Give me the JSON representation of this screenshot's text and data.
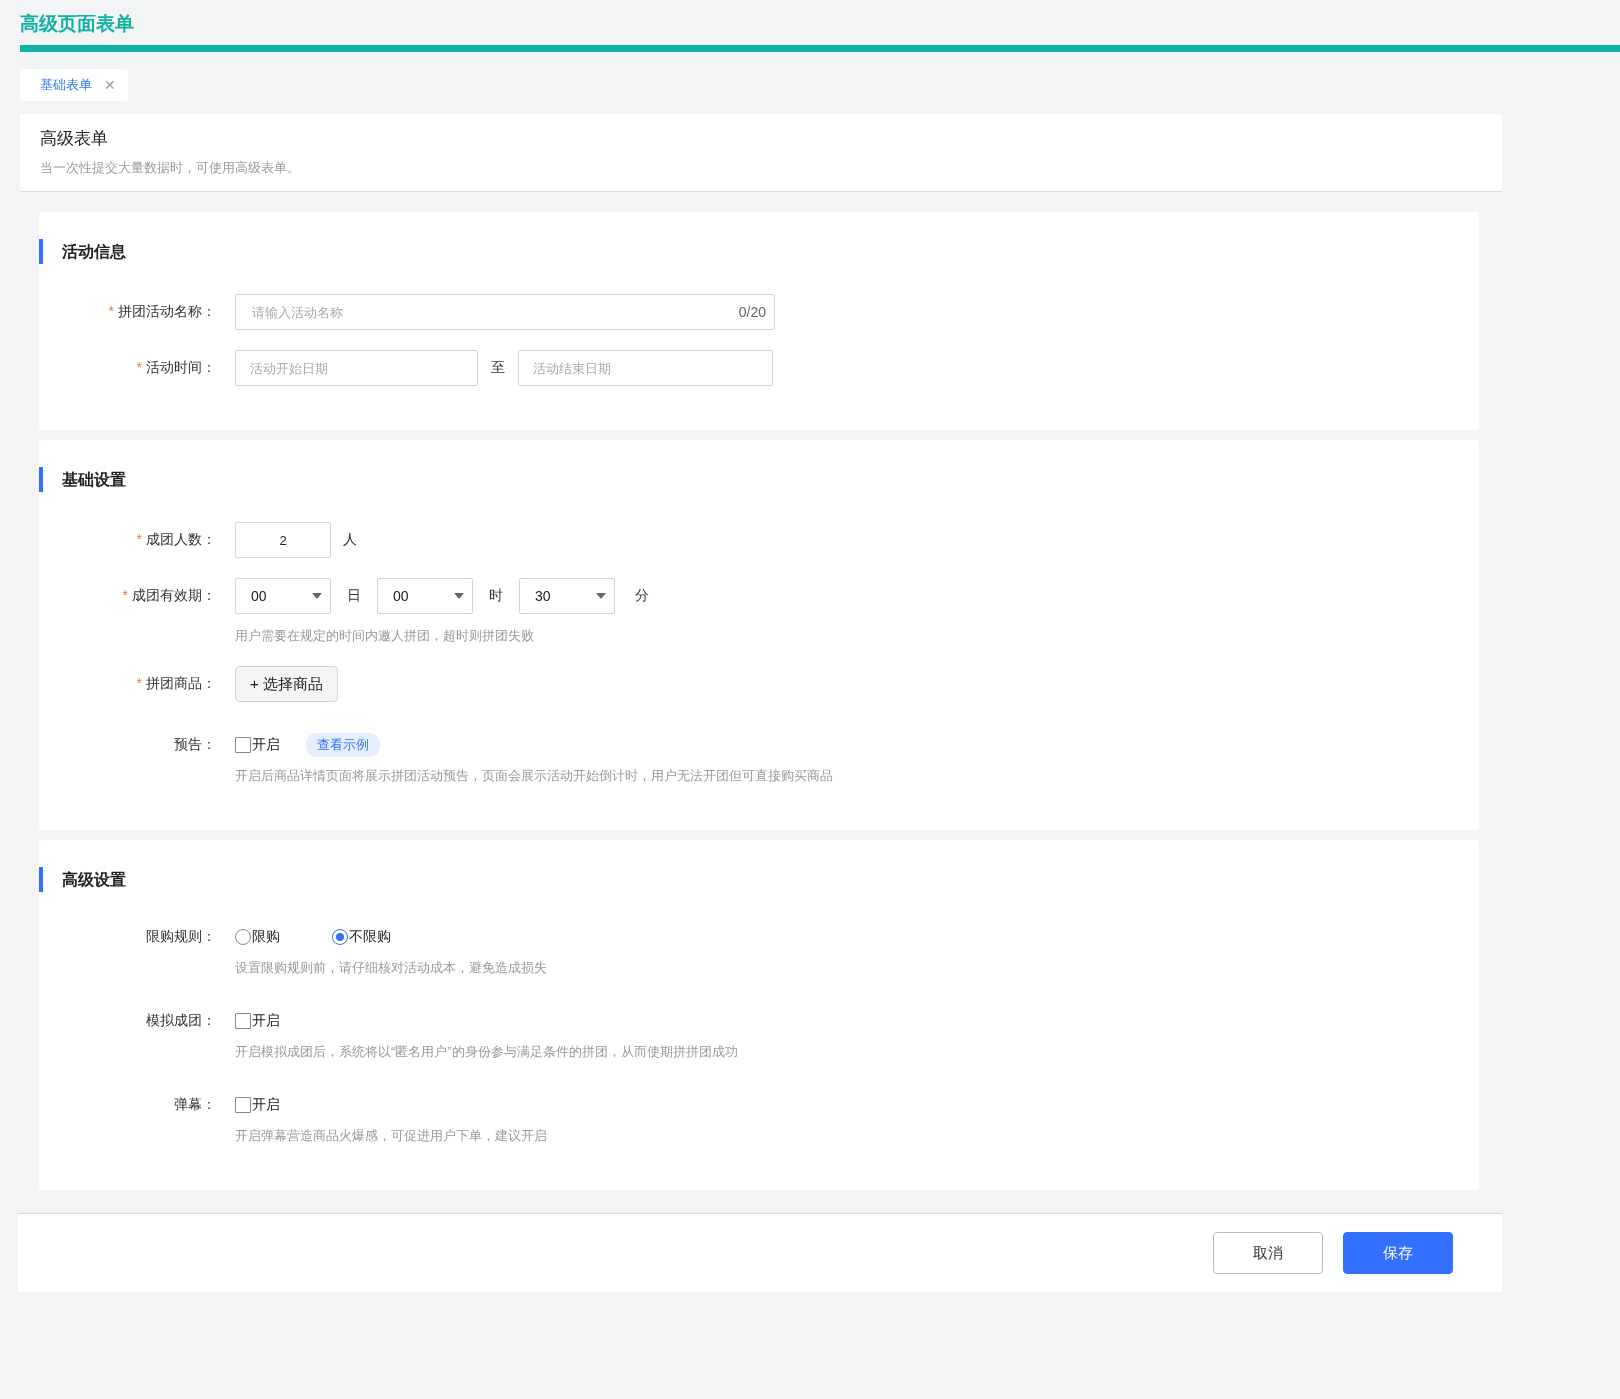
{
  "app_title": "高级页面表单",
  "tabs": [
    {
      "label": "基础表单",
      "selected": true,
      "close": "✕"
    }
  ],
  "page_header": {
    "title": "高级表单",
    "description": "当一次性提交大量数据时，可使用高级表单。"
  },
  "sections": [
    {
      "title": "活动信息",
      "fields": [
        {
          "kind": "text",
          "required_mark": "*",
          "label": "拼团活动名称：",
          "placeholder": "请输入活动名称",
          "counter": "0/20"
        },
        {
          "kind": "date_range",
          "required_mark": "*",
          "label": "活动时间：",
          "start_placeholder": "活动开始日期",
          "separator": "至",
          "end_placeholder": "活动结束日期"
        }
      ]
    },
    {
      "title": "基础设置",
      "fields": [
        {
          "kind": "number",
          "required_mark": "*",
          "label": "成团人数：",
          "value": "2",
          "unit": "人"
        },
        {
          "kind": "duration",
          "required_mark": "*",
          "label": "成团有效期：",
          "parts": [
            {
              "value": "00",
              "unit": "日"
            },
            {
              "value": "00",
              "unit": "时"
            },
            {
              "value": "30",
              "unit": "分"
            }
          ],
          "help": "用户需要在规定的时间内邀人拼团，超时则拼团失败"
        },
        {
          "kind": "button",
          "required_mark": "*",
          "label": "拼团商品：",
          "button": "+ 选择商品"
        },
        {
          "kind": "checkbox",
          "label": "预告：",
          "option": "开启",
          "checked": false,
          "link": "查看示例",
          "help": "开启后商品详情页面将展示拼团活动预告，页面会展示活动开始倒计时，用户无法开团但可直接购买商品"
        }
      ]
    },
    {
      "title": "高级设置",
      "fields": [
        {
          "kind": "radio",
          "label": "限购规则：",
          "options": [
            {
              "label": "限购",
              "selected": false
            },
            {
              "label": "不限购",
              "selected": true
            }
          ],
          "help": "设置限购规则前，请仔细核对活动成本，避免造成损失"
        },
        {
          "kind": "checkbox",
          "label": "模拟成团：",
          "option": "开启",
          "checked": false,
          "help": "开启模拟成团后，系统将以“匿名用户”的身份参与满足条件的拼团，从而使期拼拼团成功"
        },
        {
          "kind": "checkbox",
          "label": "弹幕：",
          "option": "开启",
          "checked": false,
          "help": "开启弹幕营造商品火爆感，可促进用户下单，建议开启"
        }
      ]
    }
  ],
  "footer_buttons": [
    {
      "label": "取消",
      "kind": "default"
    },
    {
      "label": "保存",
      "kind": "primary"
    }
  ]
}
